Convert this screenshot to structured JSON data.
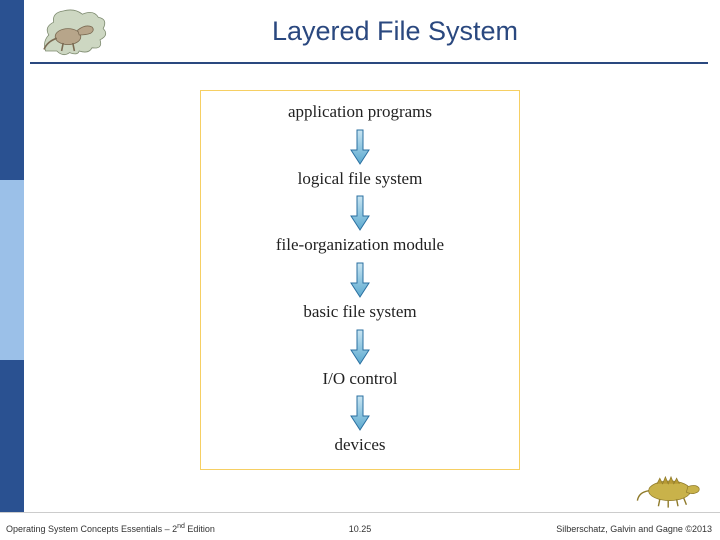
{
  "title": "Layered File System",
  "layers": {
    "l0": "application programs",
    "l1": "logical file system",
    "l2": "file-organization module",
    "l3": "basic file system",
    "l4": "I/O control",
    "l5": "devices"
  },
  "footer": {
    "left_prefix": "Operating System Concepts Essentials – 2",
    "left_ord": "nd",
    "left_suffix": " Edition",
    "center": "10.25",
    "right": "Silberschatz, Galvin and Gagne ©2013"
  },
  "colors": {
    "title": "#2a487f",
    "arrow_fill": "#6fb7d9",
    "arrow_stroke": "#2a6fa0",
    "frame": "#f6cf63"
  }
}
